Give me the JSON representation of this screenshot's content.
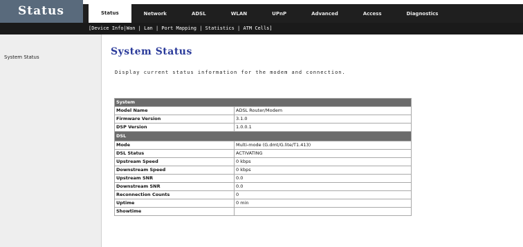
{
  "brand": "Status",
  "topnav": {
    "tabs": [
      "Status",
      "Network",
      "ADSL",
      "WLAN",
      "UPnP",
      "Advanced",
      "Access",
      "Diagnostics"
    ]
  },
  "subnav": {
    "items": [
      "Device Info",
      "Wan",
      "Lan",
      "Port Mapping",
      "Statistics",
      "ATM Cells"
    ]
  },
  "sidebar": {
    "items": [
      "System Status"
    ]
  },
  "main": {
    "title": "System Status",
    "description": "Display current status information for the modem and connection."
  },
  "table": {
    "sections": [
      {
        "title": "System",
        "rows": [
          {
            "key": "Model Name",
            "value": "ADSL Router/Modem"
          },
          {
            "key": "Firmware Version",
            "value": "3.1.0"
          },
          {
            "key": "DSP Version",
            "value": "1.0.0.1"
          }
        ]
      },
      {
        "title": "DSL",
        "rows": [
          {
            "key": "Mode",
            "value": "Multi-mode (G.dmt/G.lite/T1.413)"
          },
          {
            "key": "DSL Status",
            "value": "ACTIVATING"
          },
          {
            "key": "Upstream Speed",
            "value": "0 kbps"
          },
          {
            "key": "Downstream Speed",
            "value": "0 kbps"
          },
          {
            "key": "Upstream SNR",
            "value": "0.0"
          },
          {
            "key": "Downstream SNR",
            "value": "0.0"
          },
          {
            "key": "Reconnection Counts",
            "value": "0"
          },
          {
            "key": "Uptime",
            "value": "0 min"
          },
          {
            "key": "Showtime",
            "value": ""
          }
        ]
      }
    ]
  }
}
